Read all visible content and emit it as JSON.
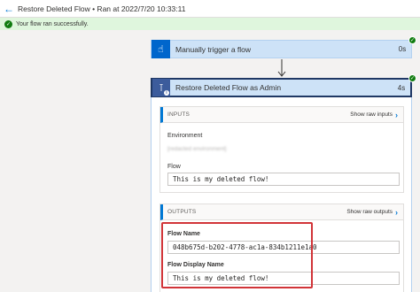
{
  "header": {
    "title": "Restore Deleted Flow • Ran at 2022/7/20 10:33:11",
    "back_icon": "arrow-left-icon"
  },
  "banner": {
    "message": "Your flow ran successfully.",
    "icon": "check-circle-icon",
    "color": "#107c10"
  },
  "steps": [
    {
      "label": "Manually trigger a flow",
      "duration": "0s",
      "icon": "touch-trigger-icon",
      "status": "succeeded"
    },
    {
      "label": "Restore Deleted Flow as Admin",
      "duration": "4s",
      "icon": "power-automate-admin-icon",
      "status": "succeeded",
      "inputs": {
        "section_label": "INPUTS",
        "show_raw": "Show raw inputs",
        "environment_label": "Environment",
        "environment_value": "[redacted environment]",
        "flow_label": "Flow",
        "flow_value": "This is my deleted flow!"
      },
      "outputs": {
        "section_label": "OUTPUTS",
        "show_raw": "Show raw outputs",
        "flow_name_label": "Flow Name",
        "flow_name_value": "048b675d-b202-4778-ac1a-834b1211e1a0",
        "flow_display_name_label": "Flow Display Name",
        "flow_display_name_value": "This is my deleted flow!"
      }
    }
  ],
  "colors": {
    "accent": "#0078d4",
    "success": "#107c10",
    "highlight": "#d13438",
    "step_header": "#cde2f7"
  }
}
